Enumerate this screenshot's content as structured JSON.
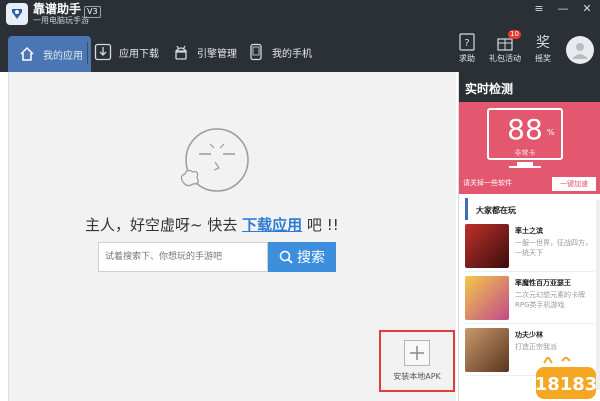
{
  "app": {
    "title": "靠谱助手",
    "subtitle": "一用电脑玩手游",
    "version": "V3"
  },
  "nav": {
    "tabs": [
      {
        "label": "我的应用",
        "icon": "home-icon",
        "active": true
      },
      {
        "label": "应用下载",
        "icon": "download-icon",
        "active": false
      },
      {
        "label": "引擎管理",
        "icon": "android-icon",
        "active": false
      },
      {
        "label": "我的手机",
        "icon": "phone-icon",
        "active": false
      }
    ],
    "tools": [
      {
        "label": "求助",
        "icon": "help-icon"
      },
      {
        "label": "礼包活动",
        "icon": "gift-icon",
        "badge": "10"
      },
      {
        "label": "摇奖",
        "icon": "lottery-icon"
      }
    ]
  },
  "empty_state": {
    "message_prefix": "主人，好空虚呀~ 快去",
    "message_link": "下载应用",
    "message_suffix": "吧 !!",
    "search_placeholder": "试着搜索下、你想玩的手游吧",
    "search_button": "搜索"
  },
  "apk": {
    "label": "安装本地APK"
  },
  "detect": {
    "title": "实时检测",
    "score": "88",
    "unit": "%",
    "status": "非常卡",
    "hint": "请关掉一些软件",
    "button": "一键加速",
    "accent": "#e3576f"
  },
  "games": {
    "title": "大家都在玩",
    "items": [
      {
        "name": "率土之滨",
        "desc": "一服一世界，征战四方，一统天下",
        "color": "#7a1d1d"
      },
      {
        "name": "率魔性百万亚瑟王",
        "desc": "二次元幻想元素的卡牌RPG类手机游戏",
        "color": "#d9a63c"
      },
      {
        "name": "功夫少林",
        "desc": "打造正宗我派",
        "color": "#8a5a3c"
      }
    ]
  },
  "colors": {
    "titlebar": "#2b2f36",
    "active_tab": "#4a76b3",
    "link": "#2e7bd4",
    "search_button": "#3d8fdd",
    "highlight_border": "#e23d3d"
  }
}
